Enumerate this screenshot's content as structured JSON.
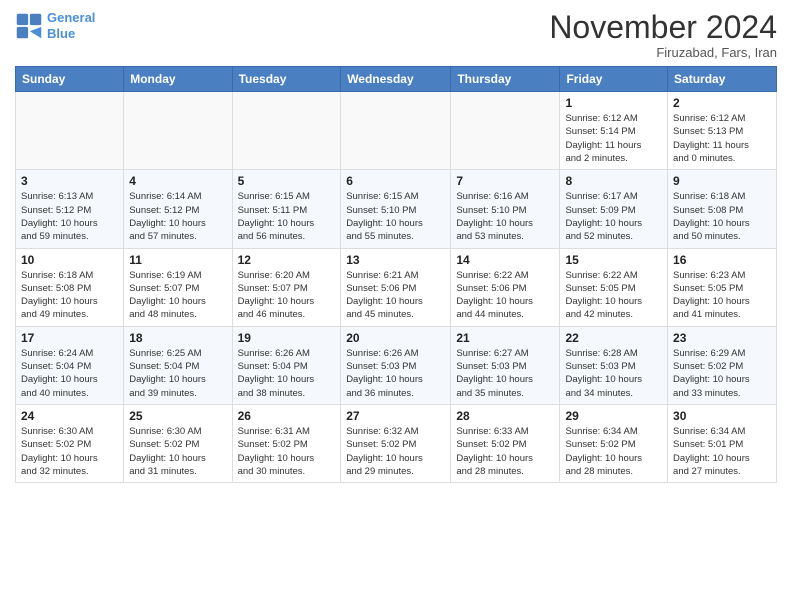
{
  "header": {
    "logo_line1": "General",
    "logo_line2": "Blue",
    "month_title": "November 2024",
    "location": "Firuzabad, Fars, Iran"
  },
  "weekdays": [
    "Sunday",
    "Monday",
    "Tuesday",
    "Wednesday",
    "Thursday",
    "Friday",
    "Saturday"
  ],
  "weeks": [
    [
      {
        "day": "",
        "info": ""
      },
      {
        "day": "",
        "info": ""
      },
      {
        "day": "",
        "info": ""
      },
      {
        "day": "",
        "info": ""
      },
      {
        "day": "",
        "info": ""
      },
      {
        "day": "1",
        "info": "Sunrise: 6:12 AM\nSunset: 5:14 PM\nDaylight: 11 hours\nand 2 minutes."
      },
      {
        "day": "2",
        "info": "Sunrise: 6:12 AM\nSunset: 5:13 PM\nDaylight: 11 hours\nand 0 minutes."
      }
    ],
    [
      {
        "day": "3",
        "info": "Sunrise: 6:13 AM\nSunset: 5:12 PM\nDaylight: 10 hours\nand 59 minutes."
      },
      {
        "day": "4",
        "info": "Sunrise: 6:14 AM\nSunset: 5:12 PM\nDaylight: 10 hours\nand 57 minutes."
      },
      {
        "day": "5",
        "info": "Sunrise: 6:15 AM\nSunset: 5:11 PM\nDaylight: 10 hours\nand 56 minutes."
      },
      {
        "day": "6",
        "info": "Sunrise: 6:15 AM\nSunset: 5:10 PM\nDaylight: 10 hours\nand 55 minutes."
      },
      {
        "day": "7",
        "info": "Sunrise: 6:16 AM\nSunset: 5:10 PM\nDaylight: 10 hours\nand 53 minutes."
      },
      {
        "day": "8",
        "info": "Sunrise: 6:17 AM\nSunset: 5:09 PM\nDaylight: 10 hours\nand 52 minutes."
      },
      {
        "day": "9",
        "info": "Sunrise: 6:18 AM\nSunset: 5:08 PM\nDaylight: 10 hours\nand 50 minutes."
      }
    ],
    [
      {
        "day": "10",
        "info": "Sunrise: 6:18 AM\nSunset: 5:08 PM\nDaylight: 10 hours\nand 49 minutes."
      },
      {
        "day": "11",
        "info": "Sunrise: 6:19 AM\nSunset: 5:07 PM\nDaylight: 10 hours\nand 48 minutes."
      },
      {
        "day": "12",
        "info": "Sunrise: 6:20 AM\nSunset: 5:07 PM\nDaylight: 10 hours\nand 46 minutes."
      },
      {
        "day": "13",
        "info": "Sunrise: 6:21 AM\nSunset: 5:06 PM\nDaylight: 10 hours\nand 45 minutes."
      },
      {
        "day": "14",
        "info": "Sunrise: 6:22 AM\nSunset: 5:06 PM\nDaylight: 10 hours\nand 44 minutes."
      },
      {
        "day": "15",
        "info": "Sunrise: 6:22 AM\nSunset: 5:05 PM\nDaylight: 10 hours\nand 42 minutes."
      },
      {
        "day": "16",
        "info": "Sunrise: 6:23 AM\nSunset: 5:05 PM\nDaylight: 10 hours\nand 41 minutes."
      }
    ],
    [
      {
        "day": "17",
        "info": "Sunrise: 6:24 AM\nSunset: 5:04 PM\nDaylight: 10 hours\nand 40 minutes."
      },
      {
        "day": "18",
        "info": "Sunrise: 6:25 AM\nSunset: 5:04 PM\nDaylight: 10 hours\nand 39 minutes."
      },
      {
        "day": "19",
        "info": "Sunrise: 6:26 AM\nSunset: 5:04 PM\nDaylight: 10 hours\nand 38 minutes."
      },
      {
        "day": "20",
        "info": "Sunrise: 6:26 AM\nSunset: 5:03 PM\nDaylight: 10 hours\nand 36 minutes."
      },
      {
        "day": "21",
        "info": "Sunrise: 6:27 AM\nSunset: 5:03 PM\nDaylight: 10 hours\nand 35 minutes."
      },
      {
        "day": "22",
        "info": "Sunrise: 6:28 AM\nSunset: 5:03 PM\nDaylight: 10 hours\nand 34 minutes."
      },
      {
        "day": "23",
        "info": "Sunrise: 6:29 AM\nSunset: 5:02 PM\nDaylight: 10 hours\nand 33 minutes."
      }
    ],
    [
      {
        "day": "24",
        "info": "Sunrise: 6:30 AM\nSunset: 5:02 PM\nDaylight: 10 hours\nand 32 minutes."
      },
      {
        "day": "25",
        "info": "Sunrise: 6:30 AM\nSunset: 5:02 PM\nDaylight: 10 hours\nand 31 minutes."
      },
      {
        "day": "26",
        "info": "Sunrise: 6:31 AM\nSunset: 5:02 PM\nDaylight: 10 hours\nand 30 minutes."
      },
      {
        "day": "27",
        "info": "Sunrise: 6:32 AM\nSunset: 5:02 PM\nDaylight: 10 hours\nand 29 minutes."
      },
      {
        "day": "28",
        "info": "Sunrise: 6:33 AM\nSunset: 5:02 PM\nDaylight: 10 hours\nand 28 minutes."
      },
      {
        "day": "29",
        "info": "Sunrise: 6:34 AM\nSunset: 5:02 PM\nDaylight: 10 hours\nand 28 minutes."
      },
      {
        "day": "30",
        "info": "Sunrise: 6:34 AM\nSunset: 5:01 PM\nDaylight: 10 hours\nand 27 minutes."
      }
    ]
  ]
}
